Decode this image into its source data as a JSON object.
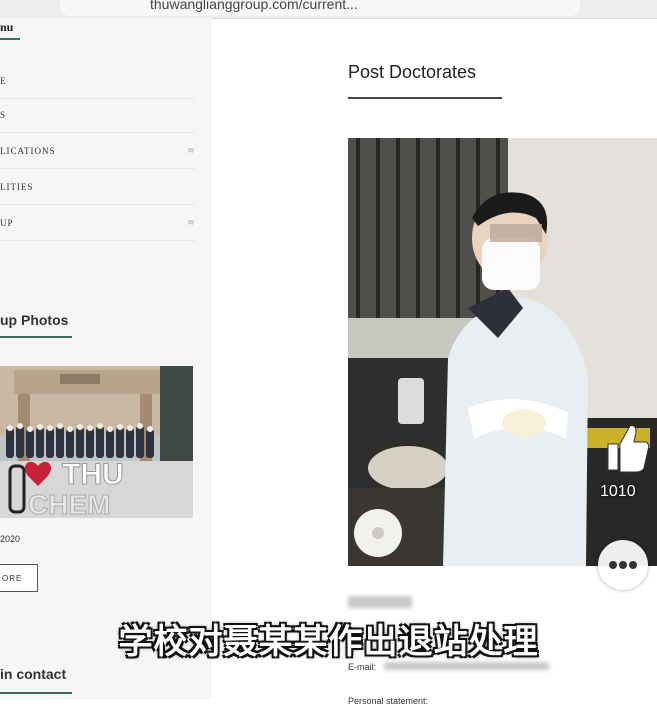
{
  "browser": {
    "url": "thuwanglianggroup.com/current..."
  },
  "sidebar": {
    "heading": "nu",
    "items": [
      {
        "label": "E",
        "has_arrow": false
      },
      {
        "label": "S",
        "has_arrow": false
      },
      {
        "label": "LICATIONS",
        "has_arrow": true
      },
      {
        "label": "LITIES",
        "has_arrow": false
      },
      {
        "label": "UP",
        "has_arrow": true
      }
    ],
    "group_photos_title": "up Photos",
    "photo_date": "2020",
    "more_label": "ORE",
    "contact_title": "in contact"
  },
  "main": {
    "title": "Post Doctorates",
    "email_label": "E-mail:",
    "statement_label": "Personal statement:"
  },
  "overlay": {
    "subtitle": "学校对聂某某作出退站处理",
    "like_count": "1010",
    "icons": [
      "thumbs-up-icon",
      "more-icon",
      "share-icon"
    ]
  },
  "colors": {
    "accent": "#3b6b5a"
  }
}
